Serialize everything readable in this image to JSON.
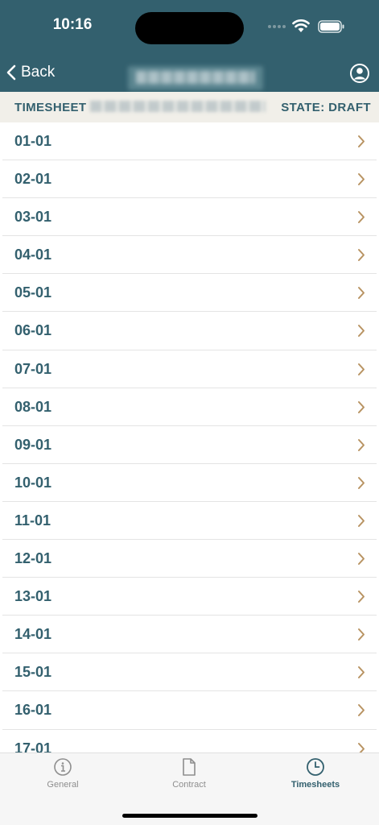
{
  "status_bar": {
    "time": "10:16"
  },
  "nav": {
    "back_label": "Back",
    "title": ""
  },
  "sheet": {
    "label": "TIMESHEET",
    "state": "STATE: DRAFT"
  },
  "rows": [
    "01-01",
    "02-01",
    "03-01",
    "04-01",
    "05-01",
    "06-01",
    "07-01",
    "08-01",
    "09-01",
    "10-01",
    "11-01",
    "12-01",
    "13-01",
    "14-01",
    "15-01",
    "16-01",
    "17-01"
  ],
  "tabs": [
    {
      "label": "General",
      "icon": "info-circle-icon",
      "active": false
    },
    {
      "label": "Contract",
      "icon": "document-icon",
      "active": false
    },
    {
      "label": "Timesheets",
      "icon": "clock-icon",
      "active": true
    }
  ],
  "colors": {
    "brand": "#33606e",
    "chevron": "#b89362",
    "tab_inactive": "#8e8e8e",
    "bar_bg": "#f1efe9"
  }
}
